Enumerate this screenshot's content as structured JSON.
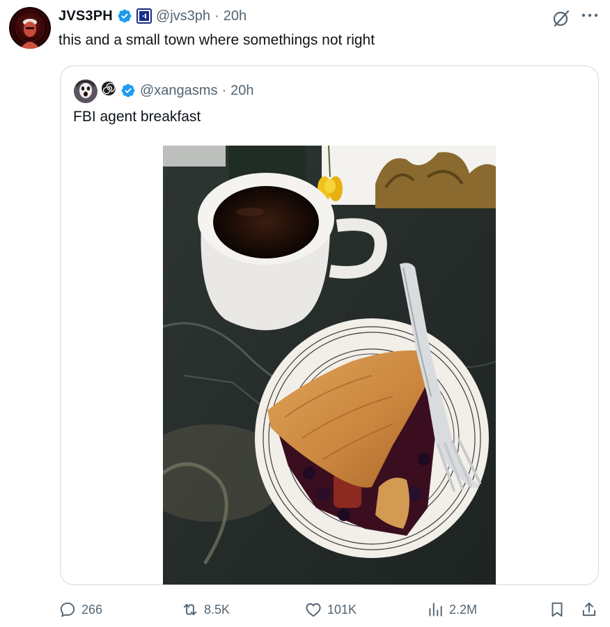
{
  "tweet": {
    "display_name": "JVS3PH",
    "handle": "@jvs3ph",
    "separator": "·",
    "time": "20h",
    "text": "this and a small town where somethings not right"
  },
  "quoted_tweet": {
    "handle": "@xangasms",
    "separator": "·",
    "time": "20h",
    "text": "FBI agent breakfast",
    "image_icon": "photo-coffee-and-pie"
  },
  "actions": {
    "replies": "266",
    "reposts": "8.5K",
    "likes": "101K",
    "views": "2.2M"
  },
  "colors": {
    "verified": "#1d9bf0",
    "muted": "#536471",
    "border": "#cfd9de"
  }
}
